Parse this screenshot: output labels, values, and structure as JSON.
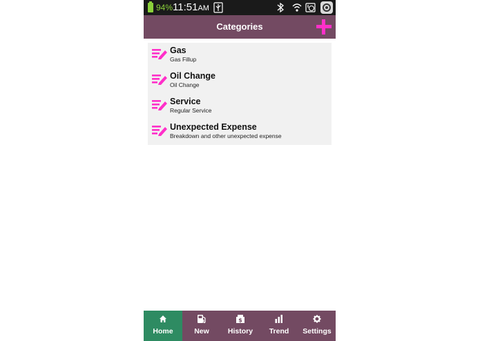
{
  "status_bar": {
    "battery": "94%",
    "time": "11:51",
    "ampm": "AM",
    "icons": [
      "battery-icon",
      "usb-icon",
      "bluetooth-icon",
      "wifi-icon",
      "data-icon",
      "camera-icon"
    ]
  },
  "app_bar": {
    "title": "Categories",
    "add_icon": "plus-icon"
  },
  "categories": [
    {
      "title": "Gas",
      "subtitle": "Gas Fillup"
    },
    {
      "title": "Oil Change",
      "subtitle": "Oil Change"
    },
    {
      "title": "Service",
      "subtitle": "Regular Service"
    },
    {
      "title": "Unexpected Expense",
      "subtitle": "Breakdown and other unexpected expense"
    }
  ],
  "bottom_nav": {
    "active": "Home",
    "tabs": [
      {
        "label": "Home",
        "icon": "home-icon"
      },
      {
        "label": "New",
        "icon": "fuel-pump-icon"
      },
      {
        "label": "History",
        "icon": "money-icon"
      },
      {
        "label": "Trend",
        "icon": "bar-chart-icon"
      },
      {
        "label": "Settings",
        "icon": "gear-icon"
      }
    ]
  },
  "colors": {
    "bar": "#734a62",
    "accent": "#ff2fc9",
    "active_tab": "#2e8b62",
    "list_bg": "#f1f1f1",
    "battery": "#8bd13a"
  }
}
